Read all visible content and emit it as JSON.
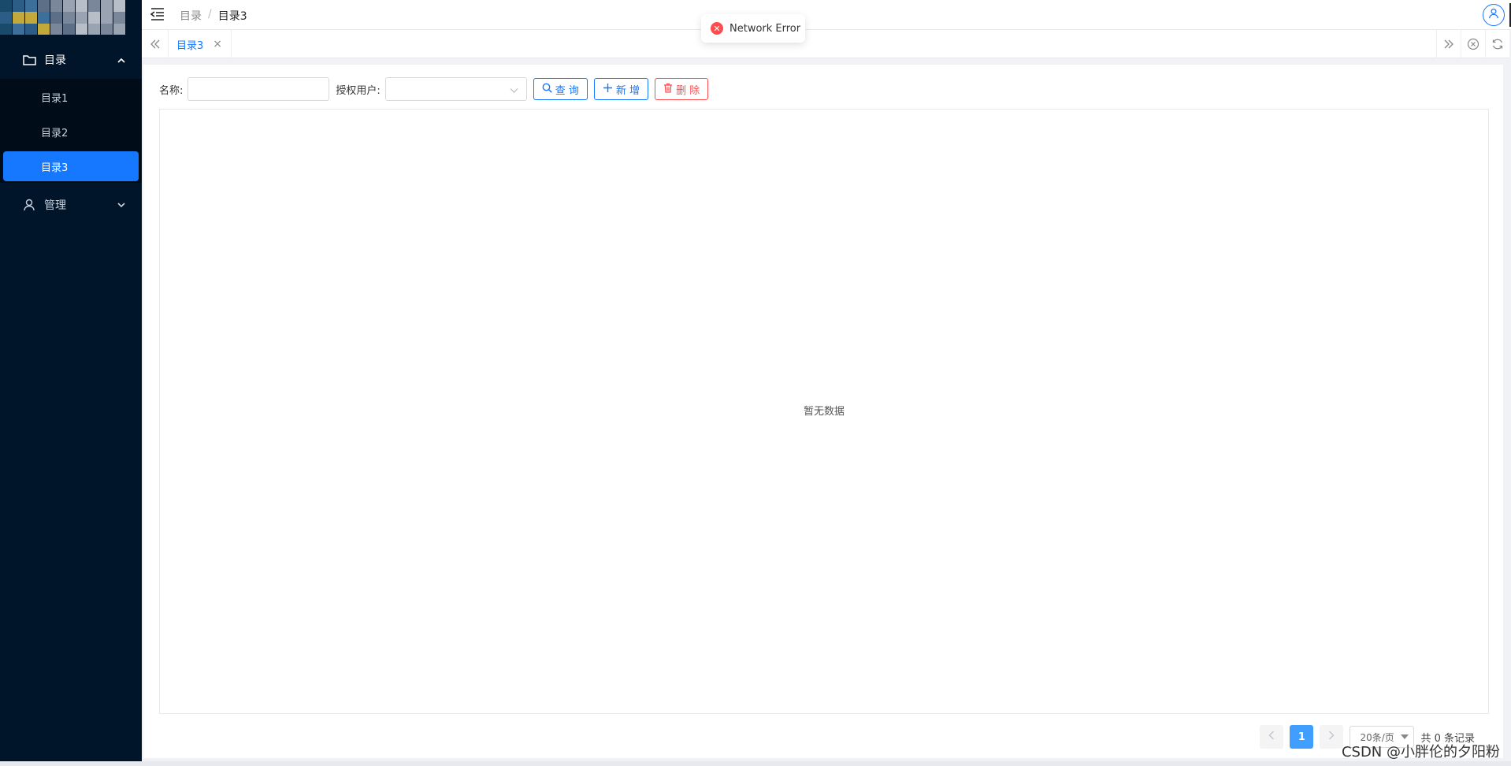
{
  "sidebar": {
    "logo_colors": [
      "#1a4a6b",
      "#2b5d86",
      "#c3a93b",
      "#3c6f9a",
      "#5d6f86",
      "#7a8699",
      "#9aa3b2",
      "#b8bec8"
    ],
    "groups": [
      {
        "label": "目录",
        "icon": "folder-icon",
        "expanded": true,
        "items": [
          {
            "label": "目录1"
          },
          {
            "label": "目录2"
          },
          {
            "label": "目录3",
            "active": true
          }
        ]
      },
      {
        "label": "管理",
        "icon": "user-icon",
        "expanded": false
      }
    ]
  },
  "header": {
    "breadcrumb": [
      "目录",
      "目录3"
    ],
    "separator": "/"
  },
  "tabs": {
    "items": [
      {
        "label": "目录3",
        "active": true,
        "close": "×"
      }
    ]
  },
  "toast": {
    "type": "error",
    "text": "Network Error"
  },
  "filter": {
    "name_label": "名称:",
    "name_value": "",
    "user_label": "授权用户:",
    "user_value": "",
    "query_label": "查 询",
    "add_label": "新 增",
    "delete_label": "删 除"
  },
  "table": {
    "empty_text": "暂无数据"
  },
  "pagination": {
    "current_page": "1",
    "page_size": "20条/页",
    "total": "共 0 条记录"
  },
  "watermark": "CSDN @小胖伦的夕阳粉",
  "colors": {
    "sidebar_bg": "#001529",
    "accent": "#1677ff",
    "danger": "#ff4d4f"
  }
}
